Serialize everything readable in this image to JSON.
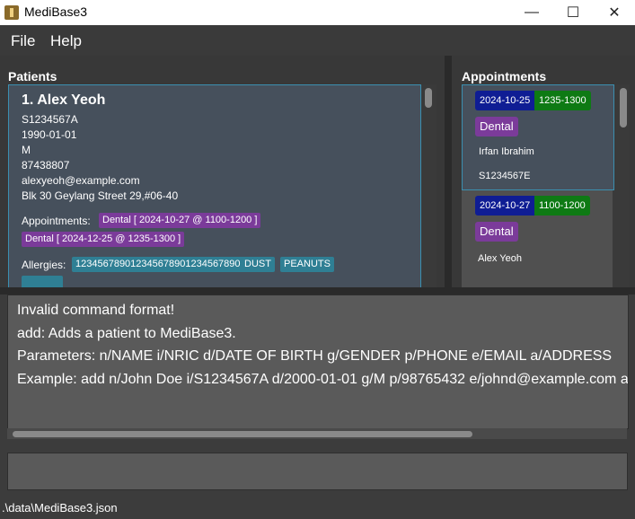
{
  "window": {
    "title": "MediBase3",
    "minimize": "—",
    "maximize": "☐",
    "close": "✕"
  },
  "menu": {
    "file": "File",
    "help": "Help"
  },
  "patients": {
    "title": "Patients",
    "card": {
      "name": "1. Alex Yeoh",
      "nric": "S1234567A",
      "dob": "1990-01-01",
      "gender": "M",
      "phone": "87438807",
      "email": "alexyeoh@example.com",
      "address": "Blk 30 Geylang Street 29,#06-40",
      "appointments_label": "Appointments:",
      "appointments": [
        "Dental [ 2024-10-27 @ 1100-1200 ]",
        "Dental [ 2024-12-25 @ 1235-1300 ]"
      ],
      "allergies_label": "Allergies:",
      "allergies": [
        "123456789012345678901234567890",
        "DUST",
        "PEANUTS"
      ]
    }
  },
  "appointments": {
    "title": "Appointments",
    "items": [
      {
        "date": "2024-10-25",
        "time": "1235-1300",
        "type": "Dental",
        "name": "Irfan Ibrahim",
        "nric": "S1234567E"
      },
      {
        "date": "2024-10-27",
        "time": "1100-1200",
        "type": "Dental",
        "name": "Alex Yeoh"
      }
    ]
  },
  "result": {
    "lines": [
      "Invalid command format!",
      "add: Adds a patient to MediBase3.",
      "Parameters: n/NAME i/NRIC d/DATE OF BIRTH g/GENDER p/PHONE e/EMAIL a/ADDRESS",
      "Example: add n/John Doe i/S1234567A d/2000-01-01 g/M p/98765432 e/johnd@example.com a/"
    ]
  },
  "command": {
    "value": ""
  },
  "status": {
    "path": ".\\data\\MediBase3.json"
  },
  "colors": {
    "date": "#0f1d94",
    "time": "#0e7a14",
    "tag_purple": "#7b3b9a",
    "tag_blue": "#2f7f94"
  }
}
